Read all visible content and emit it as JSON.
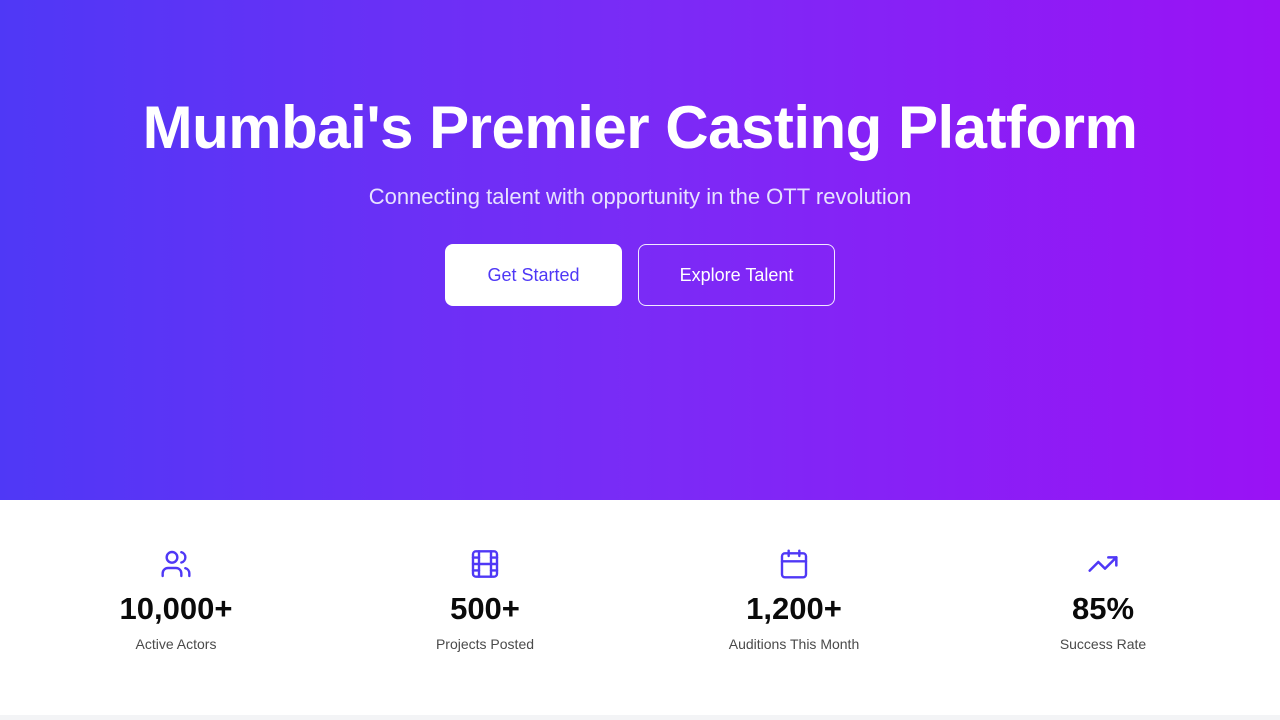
{
  "hero": {
    "title": "Mumbai's Premier Casting Platform",
    "subtitle": "Connecting talent with opportunity in the OTT revolution",
    "primary_button": "Get Started",
    "secondary_button": "Explore Talent"
  },
  "stats": [
    {
      "icon": "users-icon",
      "value": "10,000+",
      "label": "Active Actors"
    },
    {
      "icon": "film-icon",
      "value": "500+",
      "label": "Projects Posted"
    },
    {
      "icon": "calendar-icon",
      "value": "1,200+",
      "label": "Auditions This Month"
    },
    {
      "icon": "trending-up-icon",
      "value": "85%",
      "label": "Success Rate"
    }
  ],
  "colors": {
    "accent": "#4f38f6",
    "gradient_start": "#4f38f6",
    "gradient_end": "#9a12f5"
  }
}
